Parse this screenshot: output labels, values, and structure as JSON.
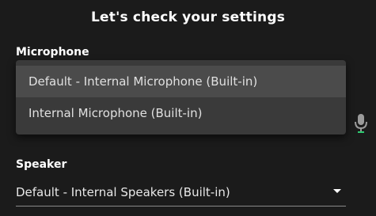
{
  "page": {
    "title": "Let's check your settings"
  },
  "microphone": {
    "label": "Microphone",
    "options": [
      "Default - Internal Microphone (Built-in)",
      "Internal Microphone (Built-in)"
    ],
    "highlighted_index": 0,
    "icon": "microphone-icon",
    "icon_accent": "#2ecc71"
  },
  "speaker": {
    "label": "Speaker",
    "selected": "Default - Internal Speakers (Built-in)",
    "icon": "chevron-down-icon"
  },
  "colors": {
    "background": "#1b1b1b",
    "menu": "#3a3a3a",
    "menu_highlight": "#4b4b4b",
    "text": "#ffffff"
  }
}
